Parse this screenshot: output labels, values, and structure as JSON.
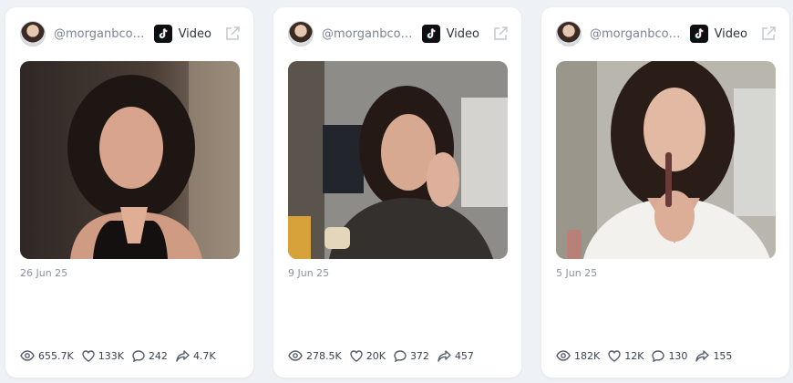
{
  "posts": [
    {
      "handle": "@morganbcohen",
      "platform_icon": "tiktok-icon",
      "type": "Video",
      "date": "26 Jun 25",
      "views": "655.7K",
      "likes": "133K",
      "comments": "242",
      "shares": "4.7K"
    },
    {
      "handle": "@morganbcohen",
      "platform_icon": "tiktok-icon",
      "type": "Video",
      "date": "9 Jun 25",
      "views": "278.5K",
      "likes": "20K",
      "comments": "372",
      "shares": "457"
    },
    {
      "handle": "@morganbcohen",
      "platform_icon": "tiktok-icon",
      "type": "Video",
      "date": "5 Jun 25",
      "views": "182K",
      "likes": "12K",
      "comments": "130",
      "shares": "155"
    }
  ],
  "colors": {
    "page_bg": "#eef1f5",
    "card_bg": "#ffffff",
    "muted_text": "#8a93a3",
    "stat_text": "#3b4250",
    "icon_stroke": "#555d6b"
  },
  "icons": [
    "eye-icon",
    "heart-icon",
    "comment-icon",
    "share-icon",
    "external-link-icon"
  ]
}
